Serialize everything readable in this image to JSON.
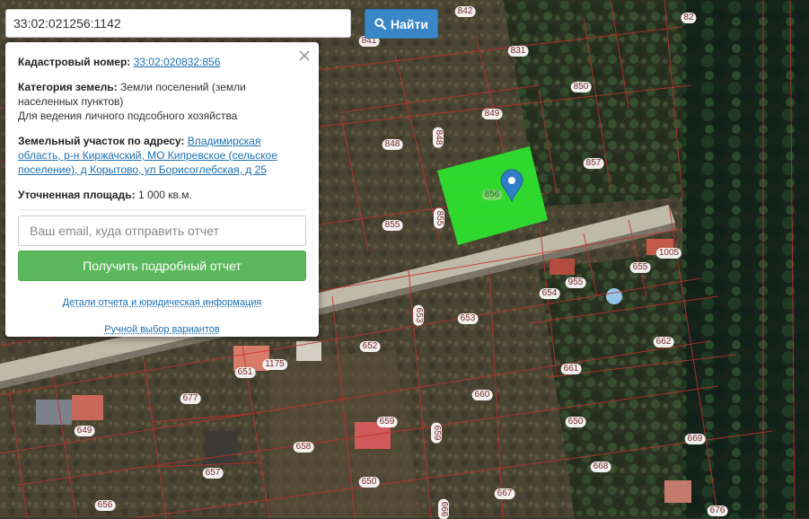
{
  "search": {
    "value": "33:02:021256:1142",
    "button_label": "Найти"
  },
  "popup": {
    "cadastral_label": "Кадастровый номер:",
    "cadastral_number": "33:02:020832:856",
    "category_label": "Категория земель:",
    "category_value_line1": "Земли поселений (земли",
    "category_value_line2": "населенных пунктов)",
    "usage": "Для ведения личного подсобного хозяйства",
    "address_label": "Земельный участок по адресу:",
    "address_part1": "Владимирская",
    "address_part2": "область, р-н Киржачский, МО Кипревское (сельское",
    "address_part3": "поселение), д Корытово, ул Борисоглебская, д 25",
    "area_label": "Уточненная площадь:",
    "area_value": "1 000 кв.м.",
    "email_placeholder": "Ваш email, куда отправить отчет",
    "report_button": "Получить подробный отчет",
    "details_link": "Детали отчета и юридическая информация",
    "manual_link": "Ручной выбор вариантов"
  },
  "map": {
    "selected_parcel": "856",
    "parcel_color": "#2ee02e",
    "marker_color": "#2f7fc8",
    "parcel_labels": [
      "842",
      "82",
      "841",
      "831",
      "850",
      "849",
      "848",
      "848",
      "857",
      "856",
      "855",
      "855",
      "1005",
      "655",
      "955",
      "654",
      "653",
      "653",
      "652",
      "651",
      "1175",
      "662",
      "661",
      "660",
      "677",
      "659",
      "659",
      "650",
      "649",
      "658",
      "669",
      "657",
      "668",
      "650",
      "667",
      "656",
      "676",
      "666"
    ]
  }
}
